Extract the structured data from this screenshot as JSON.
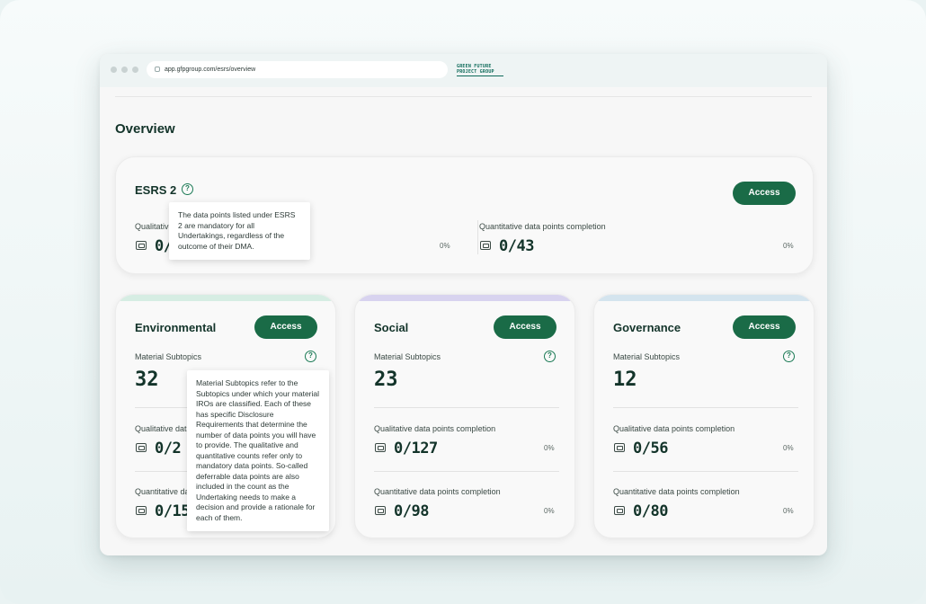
{
  "browser": {
    "url": "app.gfpgroup.com/esrs/overview",
    "logo_text": "GREEN FUTURE PROJECT GROUP"
  },
  "page": {
    "title": "Overview"
  },
  "esrs2": {
    "title": "ESRS 2",
    "access_label": "Access",
    "qualitative": {
      "label": "Qualitative data points completion",
      "value": "0/",
      "pct": "0%"
    },
    "quantitative": {
      "label": "Quantitative data points completion",
      "value": "0/43",
      "pct": "0%"
    },
    "tooltip": "The data points listed under ESRS 2 are mandatory for all Undertakings, regardless of the outcome of their DMA."
  },
  "categories": [
    {
      "title": "Environmental",
      "access_label": "Access",
      "stripe_color": "#d6ede3",
      "subtopics_label": "Material Subtopics",
      "subtopics_value": "32",
      "qualitative": {
        "label": "Qualitative data points completion",
        "value": "0/2",
        "pct": "0%"
      },
      "quantitative": {
        "label": "Quantitative data points completion",
        "value": "0/15",
        "pct": "0%"
      }
    },
    {
      "title": "Social",
      "access_label": "Access",
      "stripe_color": "#d8d3ef",
      "subtopics_label": "Material Subtopics",
      "subtopics_value": "23",
      "qualitative": {
        "label": "Qualitative data points completion",
        "value": "0/127",
        "pct": "0%"
      },
      "quantitative": {
        "label": "Quantitative data points completion",
        "value": "0/98",
        "pct": "0%"
      }
    },
    {
      "title": "Governance",
      "access_label": "Access",
      "stripe_color": "#d4e4ee",
      "subtopics_label": "Material Subtopics",
      "subtopics_value": "12",
      "qualitative": {
        "label": "Qualitative data points completion",
        "value": "0/56",
        "pct": "0%"
      },
      "quantitative": {
        "label": "Quantitative data points completion",
        "value": "0/80",
        "pct": "0%"
      }
    }
  ],
  "subtopics_tooltip": "Material Subtopics refer to the Subtopics under which your material IROs are classified. Each of these has specific Disclosure Requirements that determine the number of data points you will have to provide. The qualitative and quantitative counts refer only to mandatory data points. So-called deferrable data points are also included in the count as the Undertaking needs to make a decision and provide a rationale for each of them.",
  "colors": {
    "accent": "#1a6b47",
    "text": "#13342a"
  }
}
